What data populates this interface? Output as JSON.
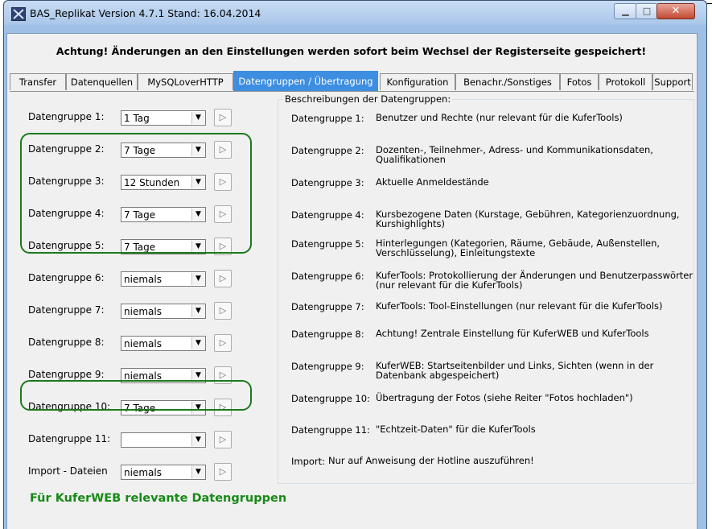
{
  "window": {
    "title": "BAS_Replikat Version 4.7.1 Stand: 16.04.2014",
    "buttons": {
      "minimize": "▁",
      "maximize": "□",
      "close": "✕"
    }
  },
  "heading": "Achtung! Änderungen an den Einstellungen werden sofort beim Wechsel der Registerseite gespeichert!",
  "tabs": [
    {
      "label": "Transfer",
      "active": false
    },
    {
      "label": "Datenquellen",
      "active": false
    },
    {
      "label": "MySQLoverHTTP",
      "active": false
    },
    {
      "label": "Datengruppen / Übertragung",
      "active": true
    },
    {
      "label": "Konfiguration",
      "active": false
    },
    {
      "label": "Benachr./Sonstiges",
      "active": false
    },
    {
      "label": "Fotos",
      "active": false
    },
    {
      "label": "Protokoll",
      "active": false
    },
    {
      "label": "Support",
      "active": false
    }
  ],
  "groups": [
    {
      "label": "Datengruppe 1:",
      "value": "1 Tag"
    },
    {
      "label": "Datengruppe 2:",
      "value": "7 Tage"
    },
    {
      "label": "Datengruppe 3:",
      "value": "12 Stunden"
    },
    {
      "label": "Datengruppe 4:",
      "value": "7 Tage"
    },
    {
      "label": "Datengruppe 5:",
      "value": "7 Tage"
    },
    {
      "label": "Datengruppe 6:",
      "value": "niemals"
    },
    {
      "label": "Datengruppe 7:",
      "value": "niemals"
    },
    {
      "label": "Datengruppe 8:",
      "value": "niemals"
    },
    {
      "label": "Datengruppe 9:",
      "value": "niemals"
    },
    {
      "label": "Datengruppe 10:",
      "value": "7 Tage"
    },
    {
      "label": "Datengruppe 11:",
      "value": ""
    },
    {
      "label": "Import - Dateien",
      "value": "niemals"
    }
  ],
  "descriptions_title": "Beschreibungen der Datengruppen:",
  "descriptions": [
    {
      "label": "Datengruppe 1:",
      "text": "Benutzer und Rechte (nur relevant für die KuferTools)"
    },
    {
      "label": "Datengruppe 2:",
      "text": "Dozenten-, Teilnehmer-, Adress- und Kommunikationsdaten, Qualifikationen"
    },
    {
      "label": "Datengruppe 3:",
      "text": "Aktuelle Anmeldestände"
    },
    {
      "label": "Datengruppe 4:",
      "text": "Kursbezogene Daten (Kurstage, Gebühren, Kategorienzuordnung, Kurshighlights)"
    },
    {
      "label": "Datengruppe 5:",
      "text": "Hinterlegungen (Kategorien, Räume, Gebäude,  Außenstellen, Verschlüsselung), Einleitungstexte"
    },
    {
      "label": "Datengruppe 6:",
      "text": "KuferTools: Protokollierung der Änderungen und Benutzerpasswörter (nur relevant für die KuferTools)"
    },
    {
      "label": "Datengruppe 7:",
      "text": "KuferTools: Tool-Einstellungen (nur relevant für die KuferTools)"
    },
    {
      "label": "Datengruppe 8:",
      "text": "Achtung! Zentrale Einstellung für KuferWEB und KuferTools"
    },
    {
      "label": "Datengruppe 9:",
      "text": "KuferWEB: Startseitenbilder und Links, Sichten (wenn in der Datenbank abgespeichert)"
    },
    {
      "label": "Datengruppe 10:",
      "text": "Übertragung der Fotos (siehe Reiter \"Fotos hochladen\")"
    },
    {
      "label": "Datengruppe 11:",
      "text": "\"Echtzeit-Daten\" für die KuferTools"
    },
    {
      "label": "Import:",
      "text": "Nur auf Anweisung der Hotline auszuführen!"
    }
  ],
  "footer": "Für KuferWEB relevante Datengruppen",
  "colors": {
    "highlight_green": "#1c7a1c",
    "active_tab": "#3d8ee1",
    "footer_text": "#168a16"
  }
}
